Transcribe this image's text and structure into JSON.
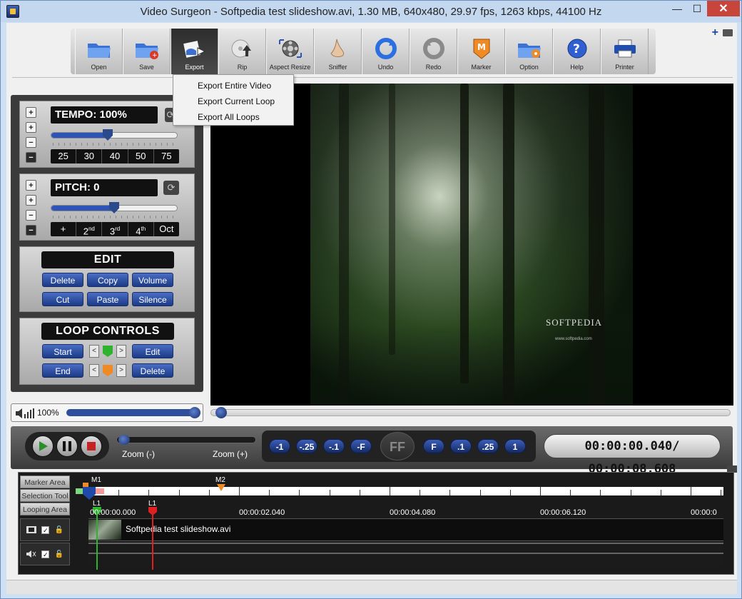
{
  "window": {
    "title": "Video Surgeon - Softpedia test slideshow.avi, 1.30 MB, 640x480, 29.97 fps, 1263 kbps, 44100 Hz",
    "buttons": {
      "minimize": "—",
      "maximize": "☐",
      "close": "✕"
    }
  },
  "toolbar": {
    "items": [
      {
        "label": "Open",
        "icon": "folder-open-icon"
      },
      {
        "label": "Save",
        "icon": "folder-save-icon"
      },
      {
        "label": "Export",
        "icon": "export-icon"
      },
      {
        "label": "Rip",
        "icon": "disc-rip-icon"
      },
      {
        "label": "Aspect Resize",
        "icon": "film-resize-icon"
      },
      {
        "label": "Sniffer",
        "icon": "nose-icon"
      },
      {
        "label": "Undo",
        "icon": "undo-icon"
      },
      {
        "label": "Redo",
        "icon": "redo-icon"
      },
      {
        "label": "Marker",
        "icon": "marker-icon"
      },
      {
        "label": "Option",
        "icon": "gear-folder-icon"
      },
      {
        "label": "Help",
        "icon": "help-icon"
      },
      {
        "label": "Printer",
        "icon": "printer-icon"
      }
    ]
  },
  "export_menu": {
    "items": [
      "Export Entire Video",
      "Export Current Loop",
      "Export All Loops"
    ]
  },
  "tempo": {
    "label": "TEMPO: 100%",
    "presets": [
      "25",
      "30",
      "40",
      "50",
      "75"
    ],
    "level": 0.45
  },
  "pitch": {
    "label": "PITCH: 0",
    "presets": [
      "+",
      "2",
      "3",
      "4",
      "Oct"
    ],
    "preset_sups": [
      "",
      "nd",
      "rd",
      "th",
      ""
    ],
    "level": 0.5
  },
  "edit": {
    "title": "EDIT",
    "buttons": [
      "Delete",
      "Copy",
      "Volume",
      "Cut",
      "Paste",
      "Silence"
    ]
  },
  "loop_controls": {
    "title": "LOOP CONTROLS",
    "start": "Start",
    "end": "End",
    "edit": "Edit",
    "delete": "Delete",
    "loop_badge": "L",
    "marker_badge": "M"
  },
  "volume": {
    "label": "100%",
    "level": 1.0
  },
  "video": {
    "watermark": "SOFTPEDIA",
    "watermark_url": "www.softpedia.com",
    "seek_level": 0.0
  },
  "transport": {
    "zoom_minus": "Zoom (-)",
    "zoom_plus": "Zoom (+)",
    "speeds_left": [
      "-1",
      "-.25",
      "-.1",
      "-F"
    ],
    "ff": "FF",
    "speeds_right": [
      "F",
      ".1",
      ".25",
      "1"
    ],
    "time": "00:00:00.040/ 00:00:08.608"
  },
  "timeline": {
    "labels": [
      "Marker Area",
      "Selection Tool",
      "Looping Area"
    ],
    "markers": [
      "M1",
      "M2"
    ],
    "loops": [
      "L1",
      "L1"
    ],
    "times": [
      "00:00:00.000",
      "00:00:02.040",
      "00:00:04.080",
      "00:00:06.120",
      "00:00:0"
    ],
    "clip_name": "Softpedia test slideshow.avi"
  },
  "colors": {
    "accent": "#2d55b8",
    "marker": "#f08a24",
    "loop_start": "#22c022",
    "loop_end": "#e02020"
  }
}
